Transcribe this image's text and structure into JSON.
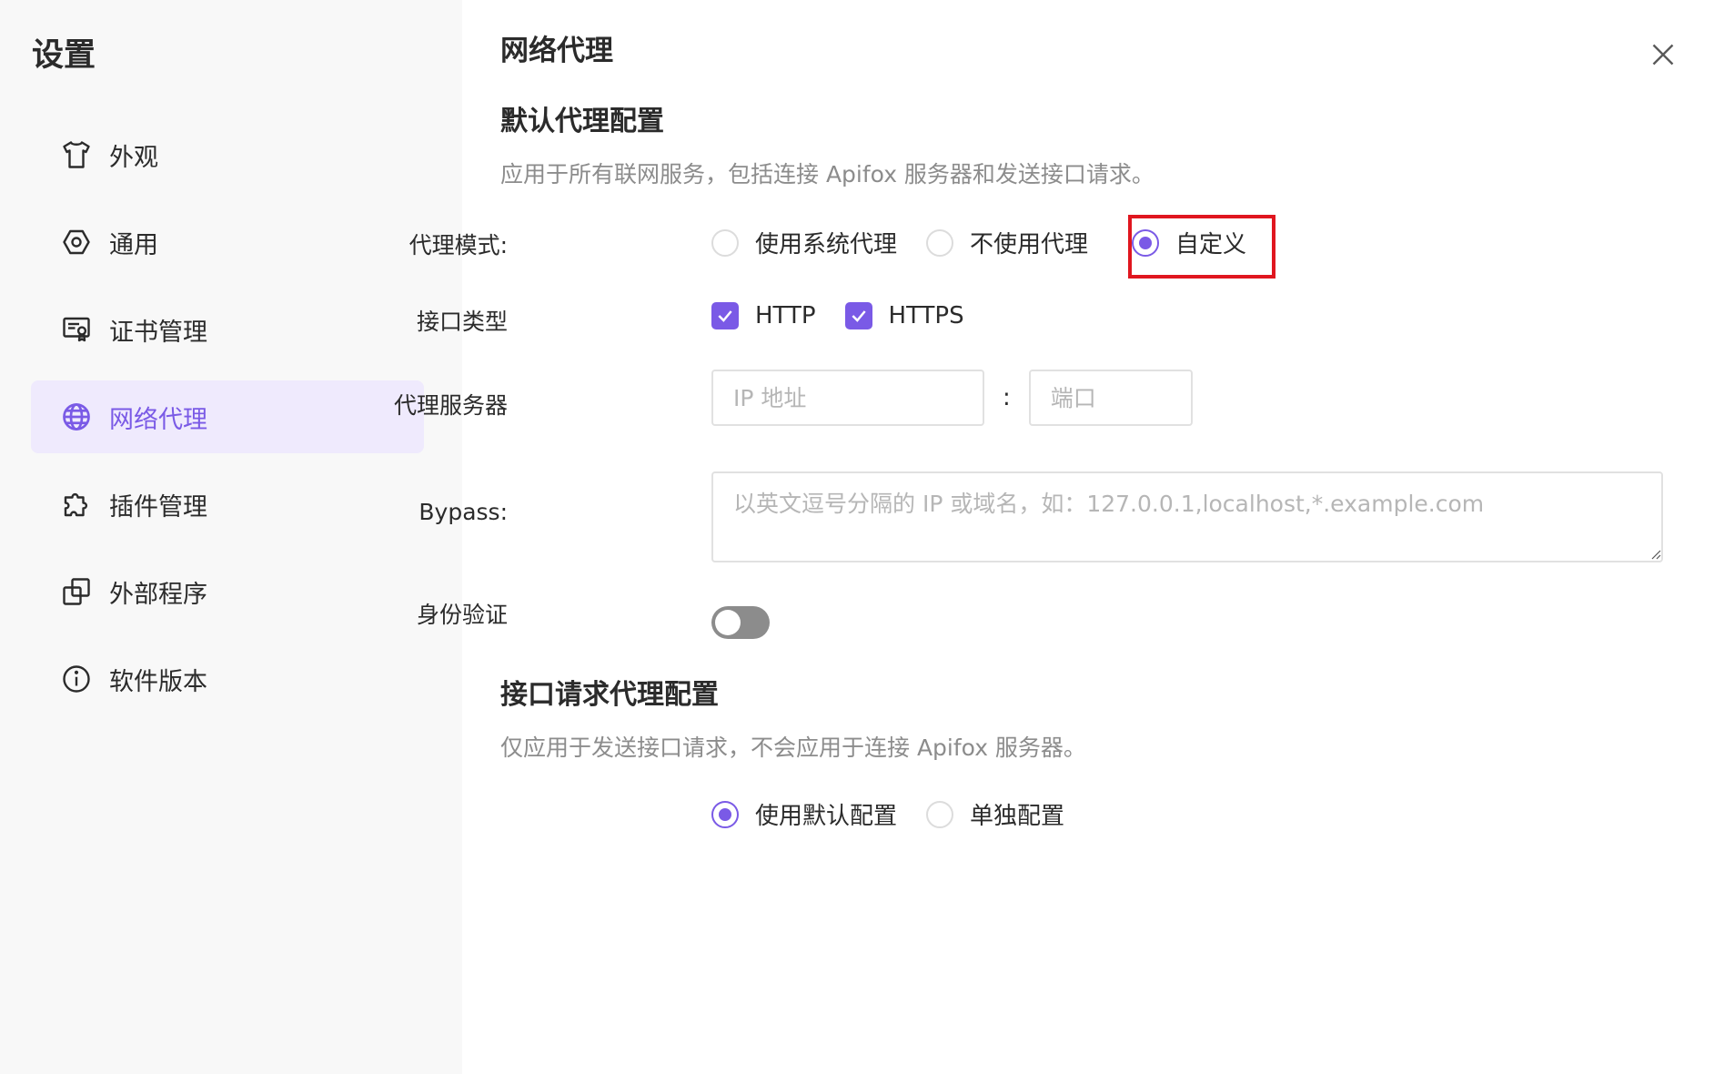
{
  "sidebar": {
    "title": "设置",
    "items": [
      {
        "label": "外观",
        "icon": "shirt-icon",
        "active": false
      },
      {
        "label": "通用",
        "icon": "gear-icon",
        "active": false
      },
      {
        "label": "证书管理",
        "icon": "certificate-icon",
        "active": false
      },
      {
        "label": "网络代理",
        "icon": "globe-icon",
        "active": true
      },
      {
        "label": "插件管理",
        "icon": "puzzle-icon",
        "active": false
      },
      {
        "label": "外部程序",
        "icon": "external-app-icon",
        "active": false
      },
      {
        "label": "软件版本",
        "icon": "info-icon",
        "active": false
      }
    ]
  },
  "main": {
    "title": "网络代理",
    "default_section": {
      "title": "默认代理配置",
      "desc": "应用于所有联网服务，包括连接 Apifox 服务器和发送接口请求。",
      "proxy_mode": {
        "label": "代理模式:",
        "options": [
          "使用系统代理",
          "不使用代理",
          "自定义"
        ],
        "selected": "自定义"
      },
      "interface_type": {
        "label": "接口类型",
        "options": [
          "HTTP",
          "HTTPS"
        ],
        "checked": [
          "HTTP",
          "HTTPS"
        ]
      },
      "proxy_server": {
        "label": "代理服务器",
        "ip_placeholder": "IP 地址",
        "colon": ":",
        "port_placeholder": "端口"
      },
      "bypass": {
        "label": "Bypass:",
        "placeholder": "以英文逗号分隔的 IP 或域名，如：127.0.0.1,localhost,*.example.com"
      },
      "auth": {
        "label": "身份验证",
        "enabled": false
      }
    },
    "request_section": {
      "title": "接口请求代理配置",
      "desc": "仅应用于发送接口请求，不会应用于连接 Apifox 服务器。",
      "options": [
        "使用默认配置",
        "单独配置"
      ],
      "selected": "使用默认配置"
    }
  },
  "colors": {
    "accent": "#7a5ae6",
    "active_bg": "#efeafd",
    "highlight": "#e0161f"
  }
}
